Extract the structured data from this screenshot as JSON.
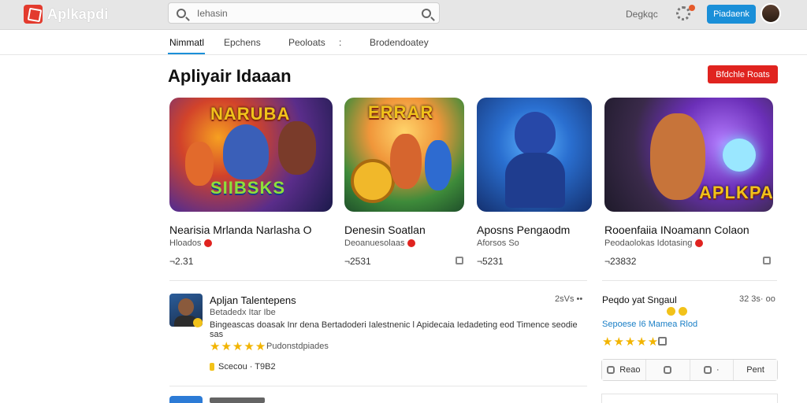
{
  "header": {
    "logo_text": "Aplkapdi",
    "search_value": "Iehasin",
    "link": "Degkqc",
    "button": "Piadaenk"
  },
  "tabs": [
    "Nimmatl",
    "Epchens",
    "Peoloats",
    ":",
    "Brodendoatey"
  ],
  "section": {
    "title": "Apliyair Idaaan",
    "button": "Bfdchle Roats"
  },
  "cards": [
    {
      "image_title": "NARUBA",
      "image_subtitle": "SIIBSKS",
      "name": "Nearisia Mrlanda Narlasha O",
      "dev": "Hloados",
      "meta": "¬2.31"
    },
    {
      "image_title": "ERRAR",
      "image_subtitle": "",
      "name": "Denesin Soatlan",
      "dev": "Deoanuesolaas",
      "meta": "¬2531"
    },
    {
      "image_title": "",
      "image_subtitle": "",
      "name": "Aposns Pengaodm",
      "dev": "Aforsos So",
      "meta": "¬5231"
    },
    {
      "image_title": "",
      "image_subtitle": "APLKPAN",
      "name": "Rooenfaiia INoamann Colaon",
      "dev": "Peodaolokas Idotasing",
      "meta": "¬23832"
    }
  ],
  "review": {
    "name": "Apljan Talentepens",
    "time": "2sVs ••",
    "sub": "Betadedx Itar Ibe",
    "body": "Bingeascas doasak Inr dena Bertadoderi Ialestnenic l Apidecaia  Iedadeting eod Timence seodie sas",
    "stars": "★★★★★",
    "stars_label": "Pudonstdpiades",
    "foot": "Scecou · T9B2"
  },
  "side": {
    "title": "Peqdo yat Sngaul",
    "time": "32 3s· oo",
    "link": "Sepoese I6 Mamea Rlod",
    "stars": "★★★★★",
    "actions": [
      "Reao",
      "",
      "",
      "Pent"
    ]
  },
  "colors": {
    "accent": "#1a8fd8",
    "brand_red": "#e0231f",
    "star": "#f2b400"
  }
}
